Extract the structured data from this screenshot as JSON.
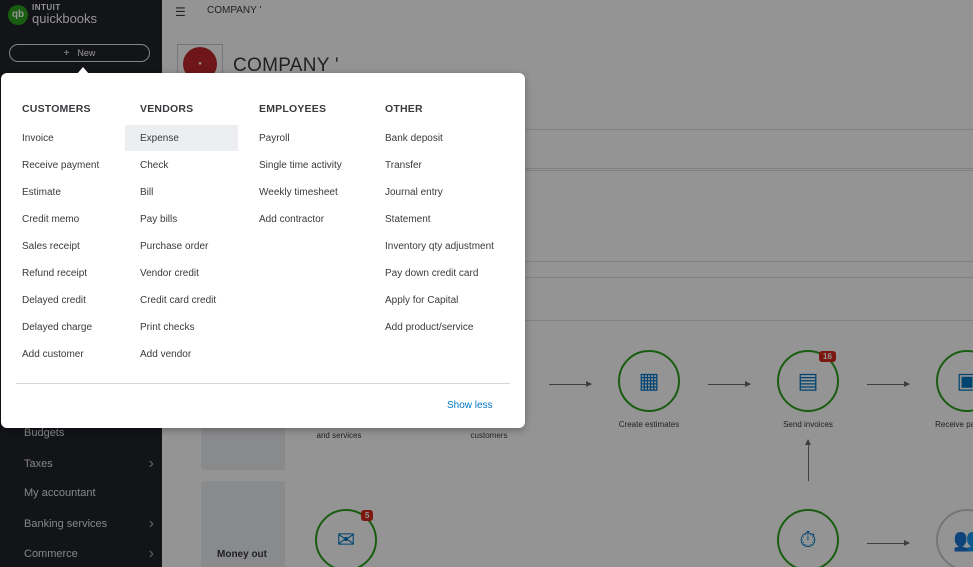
{
  "sidebar": {
    "logo_intuit": "INTUIT",
    "logo_name": "quickbooks",
    "logo_mark": "qb",
    "new_button": "New",
    "items": [
      {
        "label": "Budgets",
        "chevron": false
      },
      {
        "label": "Taxes",
        "chevron": true
      },
      {
        "label": "My accountant",
        "chevron": false
      },
      {
        "label": "Banking services",
        "chevron": true
      },
      {
        "label": "Commerce",
        "chevron": true
      }
    ]
  },
  "topbar": {
    "company": "COMPANY '"
  },
  "company": {
    "title": "COMPANY '"
  },
  "flow": {
    "labels": {
      "products": "and services",
      "customers": "customers",
      "estimates": "Create estimates",
      "invoices": "Send invoices",
      "receive": "Receive payments"
    },
    "badges": {
      "invoices": "16",
      "bills": "5"
    },
    "money_out": "Money out"
  },
  "new_menu": {
    "columns": [
      {
        "heading": "CUSTOMERS",
        "items": [
          "Invoice",
          "Receive payment",
          "Estimate",
          "Credit memo",
          "Sales receipt",
          "Refund receipt",
          "Delayed credit",
          "Delayed charge",
          "Add customer"
        ]
      },
      {
        "heading": "VENDORS",
        "items": [
          "Expense",
          "Check",
          "Bill",
          "Pay bills",
          "Purchase order",
          "Vendor credit",
          "Credit card credit",
          "Print checks",
          "Add vendor"
        ]
      },
      {
        "heading": "EMPLOYEES",
        "items": [
          "Payroll",
          "Single time activity",
          "Weekly timesheet",
          "Add contractor"
        ]
      },
      {
        "heading": "OTHER",
        "items": [
          "Bank deposit",
          "Transfer",
          "Journal entry",
          "Statement",
          "Inventory qty adjustment",
          "Pay down credit card",
          "Apply for Capital",
          "Add product/service"
        ]
      }
    ],
    "highlighted": "Expense",
    "show_less": "Show less"
  },
  "colors": {
    "sidebar_bg": "#21232a",
    "accent_green": "#2ca01c",
    "link_blue": "#0077c5",
    "badge_red": "#d52b1e"
  }
}
